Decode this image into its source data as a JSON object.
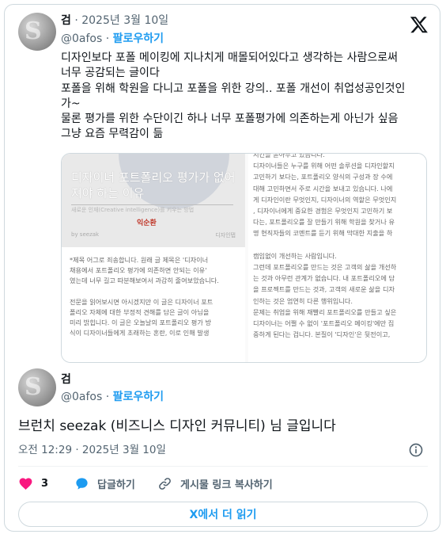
{
  "quoted": {
    "name": "검",
    "meta": " · 2025년 3월 10일",
    "handle": "@0afos",
    "follow_sep": " · ",
    "follow": "팔로우하기",
    "text_lines": [
      "디자인보다 포폴 메이킹에 지나치게 매몰되어있다고 생각하는 사람으로써",
      "너무 공감되는 글이다",
      "포폴을 위해 학원을 다니고 포폴을 위한 강의.. 포폴 개선이 취업성공인것인",
      "가~",
      "물론 평가를 위한 수단이긴 하나 너무 포폴평가에 의존하는게 아닌가 싶음",
      "그냥 요즘 무력감이 듦"
    ],
    "media": {
      "cover_title": "디자이너 포트폴리오 평가가 없어져야 하는 이유",
      "cover_subtitle": "새로운 인재(Creative intelligence)를 키우는 방법",
      "cover_author": "익순환",
      "cover_footer_left": "by seezak",
      "cover_footer_right": "디자인탭",
      "left_lines": [
        "*제목 어그로 죄송합니다. 원래 글 제목은 '디자이너",
        "채용에서 포트폴리오 평가에 의존하면 안되는 이유'",
        "였는데 너무 길고 따분해보여서 과감히 줄여보았습니다.",
        "",
        "전문을 읽어보시면 아시겠지만 이 글은 디자이너 포트",
        "폴리오 자체에 대한 부정적 견해를 담은 글이 아님을",
        "미리 밝힙니다. 이 글은 오늘날의 포트폴리오 평가 방",
        "식이 디자이너들에게 초래하는 혼란, 이로 인해 발생"
      ],
      "right_lines": [
        "시킨을 쏟아부고 있습니다.",
        "디자이너들은 누구를 위해 어떤 솔루션을 디자인할지",
        "고민하기 보다는, 포트폴리오 양식의 구성과 장 수에",
        "대해 고민하면서 주로 시간을 보내고 있습니다. 나에",
        "게 디자인이란 무엇인지, 디자이너의 역할은 무엇인지",
        ", 디자이너에게 중요한 경험은 무엇인지 고민하기 보",
        "다는, 포트폴리오를 잘 만들기 위해 학원을 찾거나 유",
        "명 현직자들의 코멘트를 듣기 위해 막대한 지출을 하",
        "",
        "캠임없이 개선하는 사람입니다.",
        "그런데 포트폴리오를 만드는 것은 고객의 삶을 개선하",
        "는 것과 아무런 관계가 없습니다. 내 포트폴리오에 담",
        "을 프로젝트를 만드는 것과, 고객의 새로운 삶을 디자",
        "인하는 것은 엄연히 다른 행위입니다.",
        "문제는 취업을 위해 재빨리 포트폴리오를 만들고 싶은",
        " 디자이너는 어쩔 수 없이 '포트폴리오 메이킹'에만 집",
        "중하게 된다는 겁니다. 본질이 '디자인'은 뒷전이고,"
      ]
    }
  },
  "tweet": {
    "name": "검",
    "handle": "@0afos",
    "follow_sep": " · ",
    "follow": "팔로우하기",
    "text": "브런치 seezak (비즈니스 디자인 커뮤니티) 님 글입니다",
    "timestamp": "오전 12:29 · 2025년 3월 10일",
    "like_count": "3",
    "reply_label": "답글하기",
    "copy_label": "게시물 링크 복사하기",
    "read_more": "X에서 더 읽기"
  },
  "colors": {
    "accent": "#1d9bf0",
    "like": "#f91880",
    "text": "#0f1419",
    "muted": "#536471"
  },
  "icons": [
    "x-logo-icon",
    "info-icon",
    "heart-icon",
    "reply-bubble-icon",
    "link-icon"
  ]
}
